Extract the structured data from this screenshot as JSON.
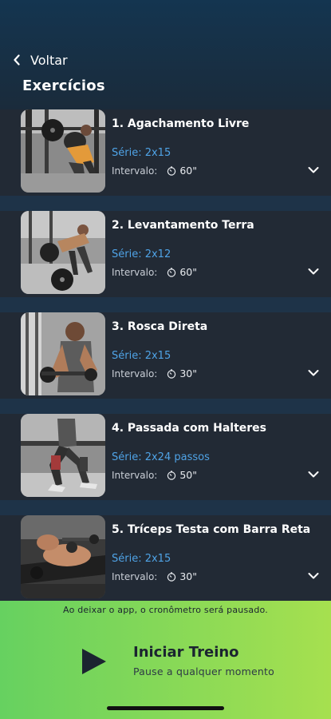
{
  "nav": {
    "back_label": "Voltar",
    "title": "Exercícios"
  },
  "labels": {
    "serie_prefix": "Série: ",
    "interval_prefix": "Intervalo:"
  },
  "exercises": [
    {
      "name": "1. Agachamento Livre",
      "serie": "Série: 2x15",
      "interval_label": "Intervalo:",
      "interval": "60\"",
      "thumb": "squat"
    },
    {
      "name": "2. Levantamento Terra",
      "serie": "Série: 2x12",
      "interval_label": "Intervalo:",
      "interval": "60\"",
      "thumb": "deadlift"
    },
    {
      "name": "3. Rosca Direta",
      "serie": "Série: 2x15",
      "interval_label": "Intervalo:",
      "interval": "30\"",
      "thumb": "curl"
    },
    {
      "name": "4. Passada com Halteres",
      "serie": "Série: 2x24 passos",
      "interval_label": "Intervalo:",
      "interval": "50\"",
      "thumb": "lunge"
    },
    {
      "name": "5. Tríceps Testa com Barra Reta",
      "serie": "Série: 2x15",
      "interval_label": "Intervalo:",
      "interval": "30\"",
      "thumb": "triceps"
    }
  ],
  "footer": {
    "notice": "Ao deixar o app, o cronômetro será pausado.",
    "start_label": "Iniciar Treino",
    "start_sub": "Pause a qualquer momento"
  },
  "colors": {
    "header_bg": "#143550",
    "card_bg": "#222a35",
    "accent_blue": "#4fa3e6",
    "footer_green_start": "#66d160",
    "footer_green_end": "#a6e04f"
  },
  "icons": {
    "back": "chevron-left-icon",
    "clock": "timer-icon",
    "expand": "chevron-down-icon",
    "play": "play-icon"
  }
}
